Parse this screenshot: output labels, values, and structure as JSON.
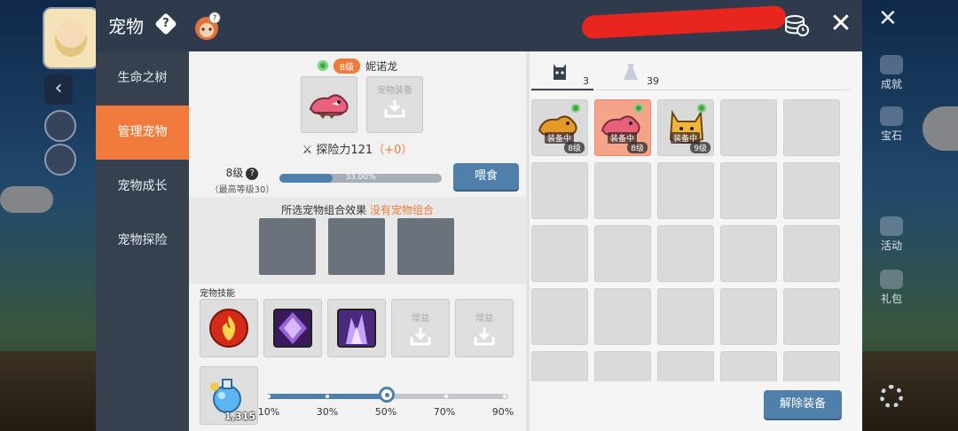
{
  "panel": {
    "title": "宠物",
    "help_glyph": "?"
  },
  "sidebar": {
    "items": [
      {
        "label": "生命之树"
      },
      {
        "label": "管理宠物"
      },
      {
        "label": "宠物成长"
      },
      {
        "label": "宠物探险"
      }
    ],
    "active_index": 1
  },
  "pet": {
    "level_badge": "8级",
    "name": "妮诺龙",
    "equip_slot_label": "宠物装备",
    "power_label": "探险力121",
    "power_bonus": "（+0）",
    "level_text": "8级",
    "level_max": "（最高等级30）",
    "xp_percent_label": "33.00%",
    "xp_fraction": 0.33,
    "feed_button": "喂食"
  },
  "combo": {
    "title": "所选宠物组合效果",
    "status": "没有宠物组合"
  },
  "skills": {
    "label": "宠物技能",
    "slots": [
      {
        "icon": "fire-skill-icon"
      },
      {
        "icon": "purple-skill-icon"
      },
      {
        "icon": "purple-crystal-skill-icon"
      },
      {
        "label": "增益"
      },
      {
        "label": "增益"
      }
    ]
  },
  "potion": {
    "count": "1,315",
    "slider_ticks": [
      "10%",
      "30%",
      "50%",
      "70%",
      "90%"
    ],
    "selected_value": 0.5
  },
  "inventory": {
    "tabs": [
      {
        "icon": "pet-bear-icon",
        "count": "3"
      },
      {
        "icon": "potion-flask-icon",
        "count": "39"
      }
    ],
    "pets": [
      {
        "equip_tag": "装备中",
        "level": "8级",
        "selected": false
      },
      {
        "equip_tag": "装备中",
        "level": "8级",
        "selected": true
      },
      {
        "equip_tag": "装备中",
        "level": "9级",
        "selected": false
      }
    ],
    "unequip_button": "解除装备"
  },
  "hud": {
    "achievement": "成就",
    "gem": "宝石",
    "event": "活动",
    "gift": "礼包"
  },
  "colors": {
    "accent_orange": "#f07a3c",
    "button_blue": "#4f7fab",
    "title_bar": "#2f3a4d",
    "sidebar": "#36404f"
  }
}
